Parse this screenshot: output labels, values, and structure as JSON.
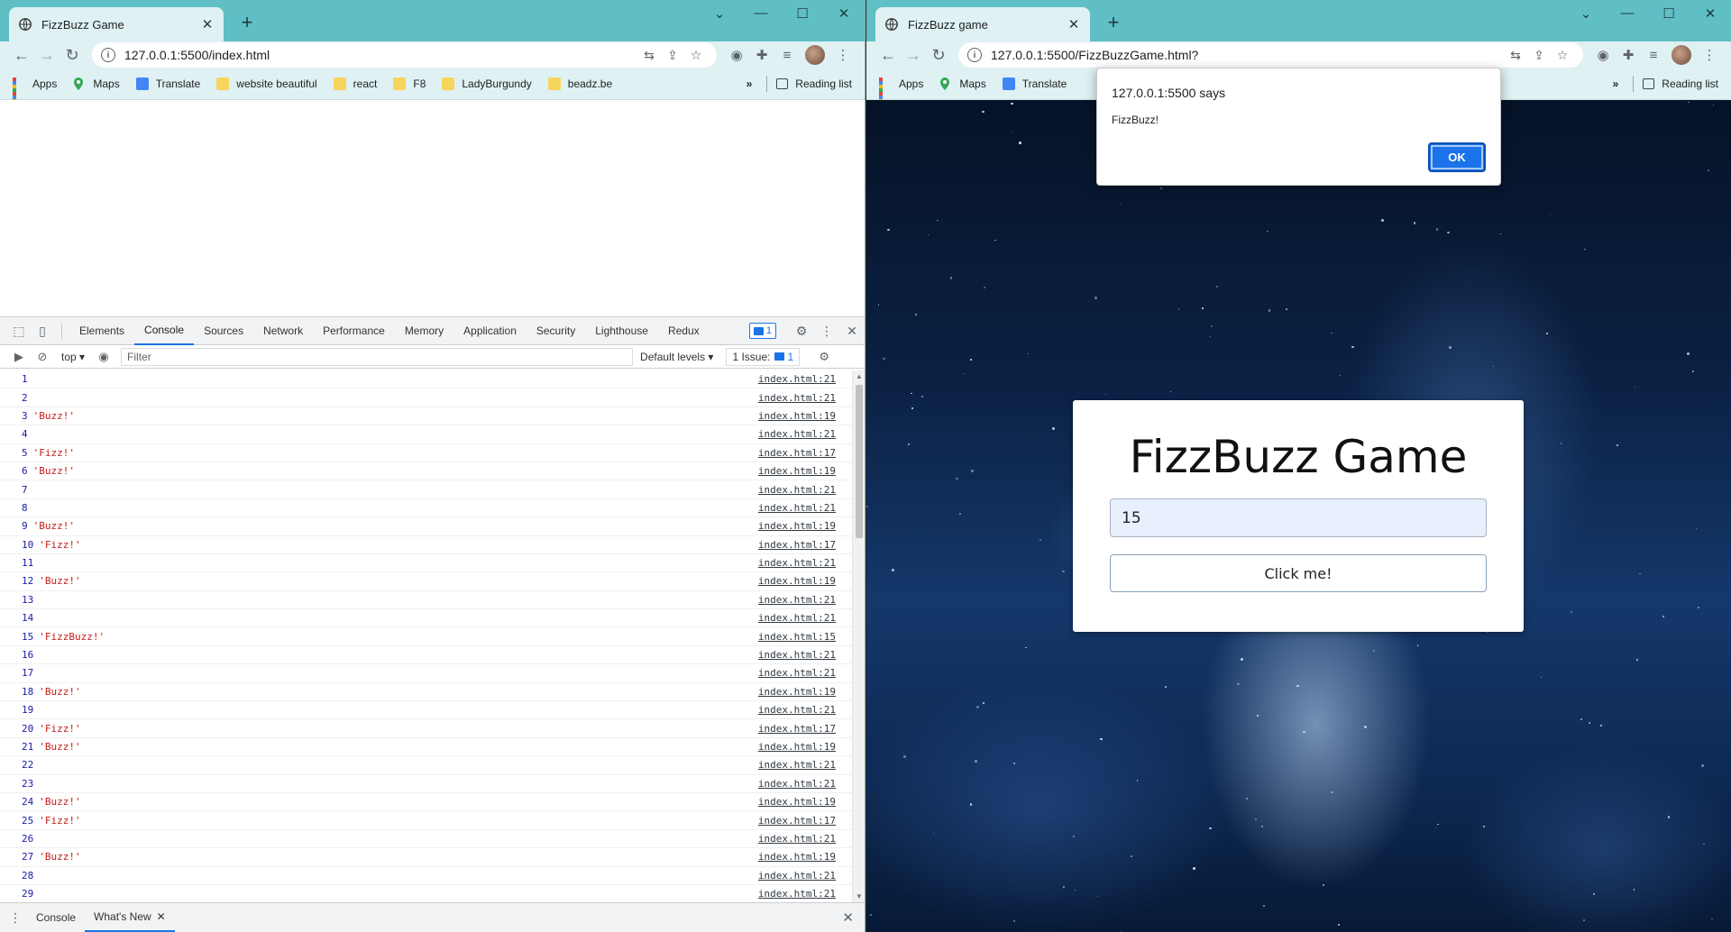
{
  "left_window": {
    "tab_title": "FizzBuzz Game",
    "url": "127.0.0.1:5500/index.html",
    "bookmarks": [
      "Apps",
      "Maps",
      "Translate",
      "website beautiful",
      "react",
      "F8",
      "LadyBurgundy",
      "beadz.be"
    ],
    "reading_list": "Reading list",
    "devtools": {
      "tabs": [
        "Elements",
        "Console",
        "Sources",
        "Network",
        "Performance",
        "Memory",
        "Application",
        "Security",
        "Lighthouse",
        "Redux"
      ],
      "active_tab": "Console",
      "issue_badge_count": "1",
      "context": "top",
      "filter_placeholder": "Filter",
      "default_levels": "Default levels",
      "issues_label": "1 Issue:",
      "issues_count": "1",
      "log": [
        {
          "n": "1",
          "s": "",
          "src": "index.html:21"
        },
        {
          "n": "2",
          "s": "",
          "src": "index.html:21"
        },
        {
          "n": "3",
          "s": "'Buzz!'",
          "src": "index.html:19"
        },
        {
          "n": "4",
          "s": "",
          "src": "index.html:21"
        },
        {
          "n": "5",
          "s": "'Fizz!'",
          "src": "index.html:17"
        },
        {
          "n": "6",
          "s": "'Buzz!'",
          "src": "index.html:19"
        },
        {
          "n": "7",
          "s": "",
          "src": "index.html:21"
        },
        {
          "n": "8",
          "s": "",
          "src": "index.html:21"
        },
        {
          "n": "9",
          "s": "'Buzz!'",
          "src": "index.html:19"
        },
        {
          "n": "10",
          "s": "'Fizz!'",
          "src": "index.html:17"
        },
        {
          "n": "11",
          "s": "",
          "src": "index.html:21"
        },
        {
          "n": "12",
          "s": "'Buzz!'",
          "src": "index.html:19"
        },
        {
          "n": "13",
          "s": "",
          "src": "index.html:21"
        },
        {
          "n": "14",
          "s": "",
          "src": "index.html:21"
        },
        {
          "n": "15",
          "s": "'FizzBuzz!'",
          "src": "index.html:15"
        },
        {
          "n": "16",
          "s": "",
          "src": "index.html:21"
        },
        {
          "n": "17",
          "s": "",
          "src": "index.html:21"
        },
        {
          "n": "18",
          "s": "'Buzz!'",
          "src": "index.html:19"
        },
        {
          "n": "19",
          "s": "",
          "src": "index.html:21"
        },
        {
          "n": "20",
          "s": "'Fizz!'",
          "src": "index.html:17"
        },
        {
          "n": "21",
          "s": "'Buzz!'",
          "src": "index.html:19"
        },
        {
          "n": "22",
          "s": "",
          "src": "index.html:21"
        },
        {
          "n": "23",
          "s": "",
          "src": "index.html:21"
        },
        {
          "n": "24",
          "s": "'Buzz!'",
          "src": "index.html:19"
        },
        {
          "n": "25",
          "s": "'Fizz!'",
          "src": "index.html:17"
        },
        {
          "n": "26",
          "s": "",
          "src": "index.html:21"
        },
        {
          "n": "27",
          "s": "'Buzz!'",
          "src": "index.html:19"
        },
        {
          "n": "28",
          "s": "",
          "src": "index.html:21"
        },
        {
          "n": "29",
          "s": "",
          "src": "index.html:21"
        }
      ],
      "drawer_tabs": [
        "Console",
        "What's New"
      ]
    }
  },
  "right_window": {
    "tab_title": "FizzBuzz game",
    "url": "127.0.0.1:5500/FizzBuzzGame.html?",
    "bookmarks": [
      "Apps",
      "Maps",
      "Translate"
    ],
    "reading_list": "Reading list",
    "alert": {
      "origin": "127.0.0.1:5500 says",
      "message": "FizzBuzz!",
      "ok_label": "OK"
    },
    "game": {
      "title": "FizzBuzz Game",
      "input_value": "15",
      "button_label": "Click me!"
    }
  },
  "colors": {
    "tabstrip": "#5fbfc5",
    "toolbar": "#dff1f2",
    "accent": "#1a73e8",
    "console_string": "#c41a16",
    "console_number": "#1a1aa6"
  }
}
